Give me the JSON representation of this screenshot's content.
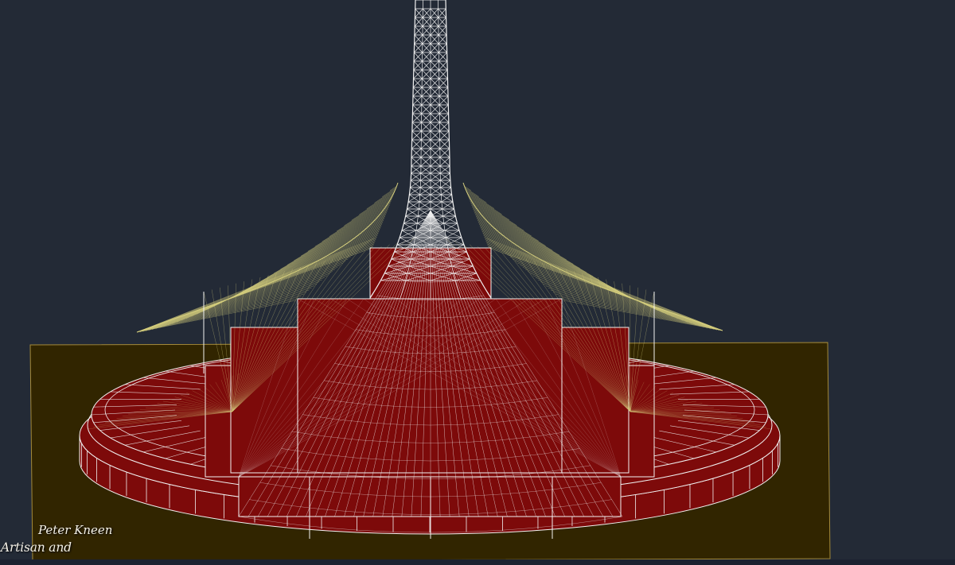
{
  "viewport": {
    "background_color": "#232a36",
    "visual_style": "wireframe-shaded"
  },
  "model": {
    "colors": {
      "ground_plane": "#312500",
      "ground_edge": "#a48a3a",
      "base_fill": "#7d0a0a",
      "white_lines": "#f2f2f2",
      "yellow_mesh": "#d6cf7e"
    }
  },
  "watermark": {
    "name": "Peter Kneen",
    "role": "Artisan and Photographer"
  }
}
